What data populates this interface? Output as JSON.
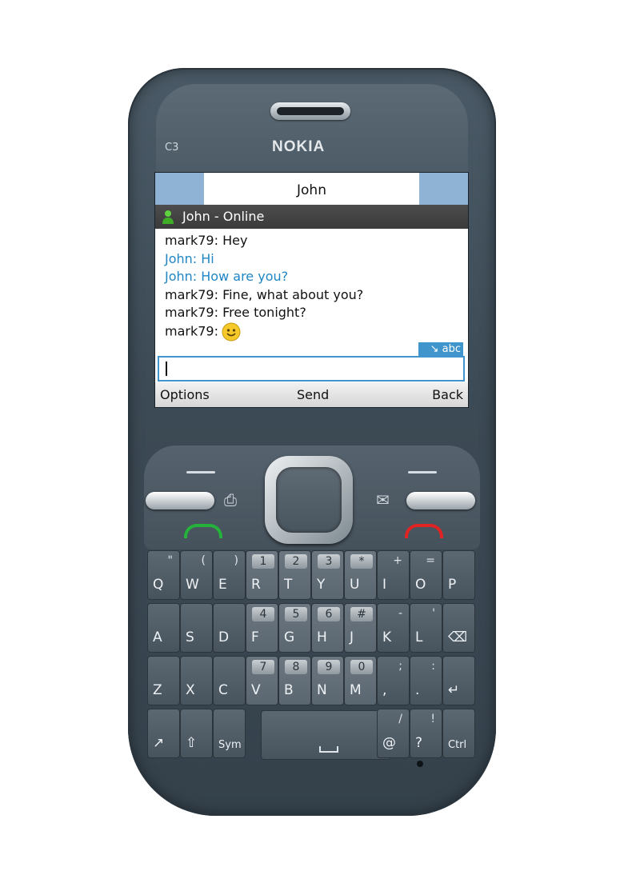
{
  "device": {
    "brand": "NOKIA",
    "model": "C3"
  },
  "screen": {
    "title": "John",
    "contact_status": "John - Online",
    "messages": [
      {
        "sender": "mark79",
        "text": "mark79: Hey",
        "type": "self"
      },
      {
        "sender": "John",
        "text": "John: Hi",
        "type": "peer"
      },
      {
        "sender": "John",
        "text": "John: How are you?",
        "type": "peer"
      },
      {
        "sender": "mark79",
        "text": "mark79: Fine, what about you?",
        "type": "self"
      },
      {
        "sender": "mark79",
        "text": "mark79: Free tonight?",
        "type": "self"
      },
      {
        "sender": "mark79",
        "text": "mark79:",
        "type": "self",
        "emoticon": "smiley-icon"
      }
    ],
    "input_mode": "abc",
    "input_value": "",
    "softkeys": {
      "left": "Options",
      "middle": "Send",
      "right": "Back"
    }
  },
  "keypad": {
    "row1": [
      {
        "primary": "Q",
        "secondary": "\""
      },
      {
        "primary": "W",
        "secondary": "("
      },
      {
        "primary": "E",
        "secondary": ")"
      },
      {
        "primary": "R",
        "number": "1"
      },
      {
        "primary": "T",
        "number": "2"
      },
      {
        "primary": "Y",
        "number": "3"
      },
      {
        "primary": "U",
        "number": "*"
      },
      {
        "primary": "I",
        "secondary": "+"
      },
      {
        "primary": "O",
        "secondary": "="
      },
      {
        "primary": "P",
        "secondary": ""
      }
    ],
    "row2": [
      {
        "primary": "A",
        "secondary": ""
      },
      {
        "primary": "S",
        "secondary": ""
      },
      {
        "primary": "D",
        "secondary": ""
      },
      {
        "primary": "F",
        "number": "4"
      },
      {
        "primary": "G",
        "number": "5"
      },
      {
        "primary": "H",
        "number": "6"
      },
      {
        "primary": "J",
        "number": "#"
      },
      {
        "primary": "K",
        "secondary": "-"
      },
      {
        "primary": "L",
        "secondary": "'"
      },
      {
        "primary": "⌫",
        "secondary": ""
      }
    ],
    "row3": [
      {
        "primary": "Z",
        "secondary": ""
      },
      {
        "primary": "X",
        "secondary": ""
      },
      {
        "primary": "C",
        "secondary": ""
      },
      {
        "primary": "V",
        "number": "7"
      },
      {
        "primary": "B",
        "number": "8"
      },
      {
        "primary": "N",
        "number": "9"
      },
      {
        "primary": "M",
        "number": "0"
      },
      {
        "primary": ",",
        "secondary": ";"
      },
      {
        "primary": ".",
        "secondary": ":"
      },
      {
        "primary": "↵",
        "secondary": ""
      }
    ],
    "row4_left": [
      {
        "primary": "↗",
        "secondary": ""
      },
      {
        "primary": "⇧",
        "secondary": ""
      },
      {
        "primary": "Sym",
        "secondary": ""
      }
    ],
    "row4_right": [
      {
        "primary": "@",
        "secondary": "/"
      },
      {
        "primary": "?",
        "secondary": "!"
      },
      {
        "primary": "Ctrl",
        "secondary": ""
      }
    ]
  },
  "colors": {
    "accent": "#3f95cc",
    "peer_text": "#1f86c6",
    "title_bar": "#8fb3d4",
    "phone_body": "#3c4a55"
  }
}
